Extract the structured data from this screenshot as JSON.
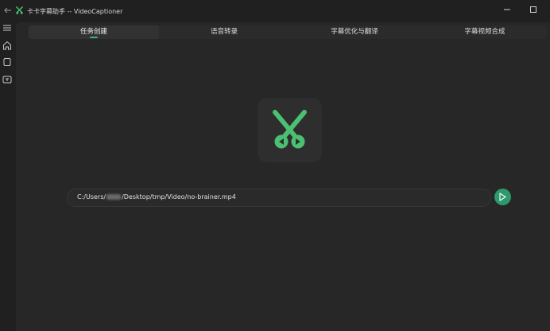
{
  "window": {
    "title": "卡卡字幕助手 -- VideoCaptioner"
  },
  "tabs": [
    {
      "label": "任务创建",
      "active": true
    },
    {
      "label": "语音转录",
      "active": false
    },
    {
      "label": "字幕优化与翻译",
      "active": false
    },
    {
      "label": "字幕视频合成",
      "active": false
    }
  ],
  "main": {
    "path_prefix": "C:/Users/",
    "path_suffix": "/Desktop/tmp/Video/no-brainer.mp4"
  },
  "colors": {
    "accent": "#3fb07a",
    "logo_green": "#4cc072",
    "run_button": "#2d9a6d"
  }
}
